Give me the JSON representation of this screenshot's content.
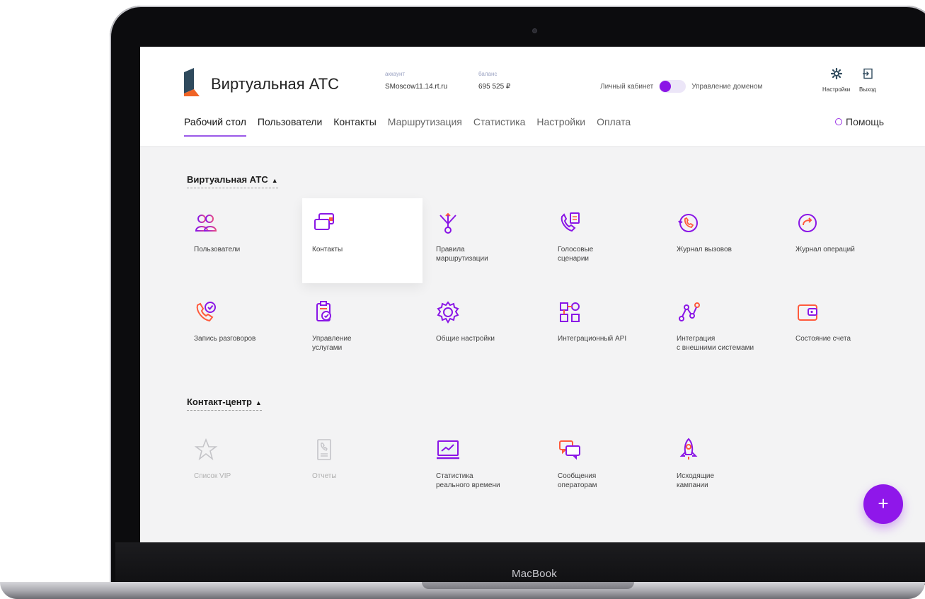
{
  "device": {
    "brand_label": "MacBook"
  },
  "header": {
    "app_title": "Виртуальная АТС",
    "account_label": "аккаунт",
    "account_value": "SMoscow11.14.rt.ru",
    "balance_label": "баланс",
    "balance_value": "695 525 ₽",
    "toggle_left_label": "Личный кабинет",
    "toggle_right_label": "Управление доменом",
    "settings_label": "Настройки",
    "logout_label": "Выход",
    "accent_color": "#8a16e6",
    "logo_colors": [
      "#2f4a5d",
      "#f06426"
    ]
  },
  "nav": {
    "items": [
      {
        "label": "Рабочий стол",
        "active": true
      },
      {
        "label": "Пользователи"
      },
      {
        "label": "Контакты"
      },
      {
        "label": "Маршрутизация"
      },
      {
        "label": "Статистика"
      },
      {
        "label": "Настройки"
      },
      {
        "label": "Оплата"
      }
    ],
    "help_label": "Помощь"
  },
  "sections": [
    {
      "title": "Виртуальная АТС",
      "tiles": [
        {
          "label": "Пользователи",
          "icon": "users-icon"
        },
        {
          "label": "Контакты",
          "icon": "contacts-icon"
        },
        {
          "label": "Правила\nмаршрутизации",
          "icon": "routing-icon"
        },
        {
          "label": "Голосовые\nсценарии",
          "icon": "voice-scenario-icon"
        },
        {
          "label": "Журнал вызовов",
          "icon": "call-log-icon"
        },
        {
          "label": "Журнал операций",
          "icon": "operations-log-icon"
        },
        {
          "label": "Запись разговоров",
          "icon": "call-recording-icon"
        },
        {
          "label": "Управление\nуслугами",
          "icon": "services-icon"
        },
        {
          "label": "Общие настройки",
          "icon": "gear-icon"
        },
        {
          "label": "Интеграционный API",
          "icon": "api-icon"
        },
        {
          "label": "Интеграция\nс внешними системами",
          "icon": "integration-icon"
        },
        {
          "label": "Состояние счета",
          "icon": "wallet-icon"
        }
      ]
    },
    {
      "title": "Контакт-центр",
      "tiles": [
        {
          "label": "Список VIP",
          "icon": "star-icon",
          "disabled": true
        },
        {
          "label": "Отчеты",
          "icon": "report-icon",
          "disabled": true
        },
        {
          "label": "Статистика\nреального времени",
          "icon": "realtime-stats-icon"
        },
        {
          "label": "Сообщения\nоператорам",
          "icon": "messages-icon"
        },
        {
          "label": "Исходящие\nкампании",
          "icon": "rocket-icon"
        }
      ]
    }
  ],
  "fab": {
    "label": "+"
  }
}
